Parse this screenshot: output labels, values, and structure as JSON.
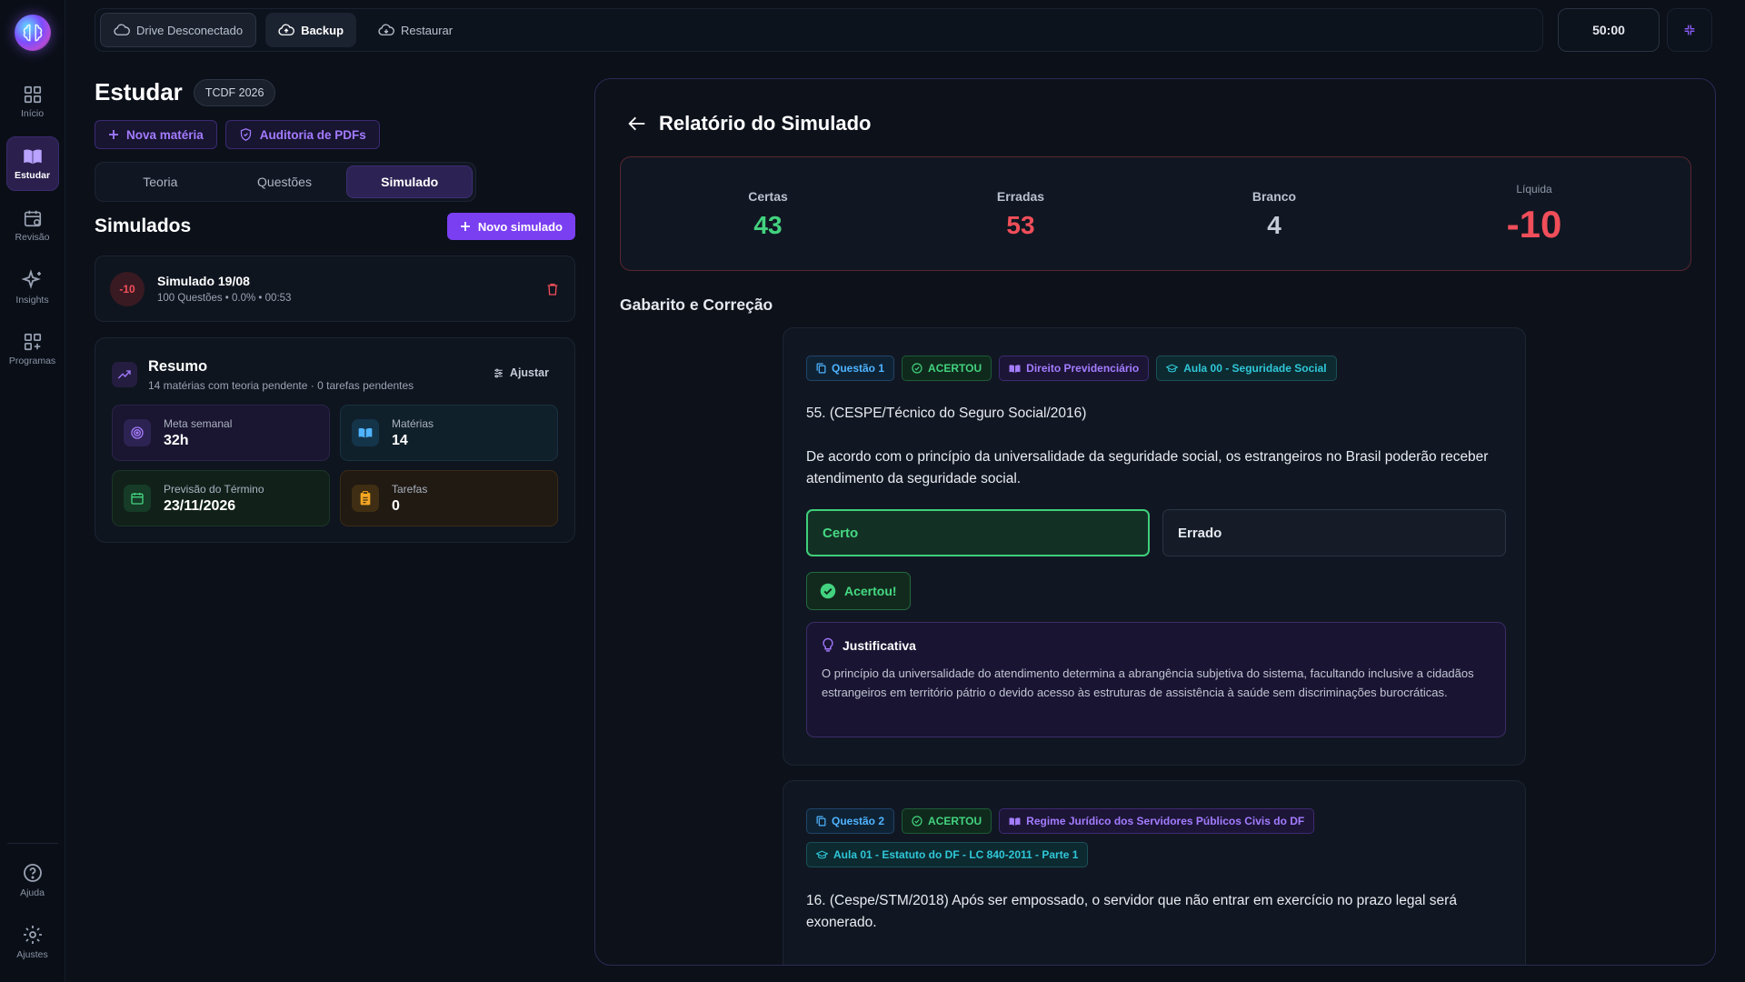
{
  "sidebar": {
    "items": [
      {
        "label": "Início",
        "icon": "grid-icon",
        "active": false
      },
      {
        "label": "Estudar",
        "icon": "book-icon",
        "active": true
      },
      {
        "label": "Revisão",
        "icon": "calendar-icon",
        "active": false
      },
      {
        "label": "Insights",
        "icon": "sparkles-icon",
        "active": false
      },
      {
        "label": "Programas",
        "icon": "apps-icon",
        "active": false
      }
    ],
    "bottom": [
      {
        "label": "Ajuda",
        "icon": "help-icon"
      },
      {
        "label": "Ajustes",
        "icon": "gear-icon"
      }
    ]
  },
  "topbar": {
    "drive": "Drive Desconectado",
    "backup": "Backup",
    "restore": "Restaurar",
    "timer": "50:00"
  },
  "page": {
    "title": "Estudar",
    "badge": "TCDF 2026",
    "new_subject": "Nova matéria",
    "audit": "Auditoria de PDFs",
    "tabs": [
      "Teoria",
      "Questões",
      "Simulado"
    ],
    "active_tab": "Simulado"
  },
  "simulados": {
    "title": "Simulados",
    "new_button": "Novo simulado",
    "items": [
      {
        "score": "-10",
        "name": "Simulado 19/08",
        "meta": "100 Questões • 0.0% • 00:53"
      }
    ]
  },
  "resumo": {
    "title": "Resumo",
    "subtitle": "14 matérias com teoria pendente · 0 tarefas pendentes",
    "adjust": "Ajustar",
    "stats": {
      "meta": {
        "label": "Meta semanal",
        "value": "32h"
      },
      "materias": {
        "label": "Matérias",
        "value": "14"
      },
      "previsao": {
        "label": "Previsão do Término",
        "value": "23/11/2026"
      },
      "tarefas": {
        "label": "Tarefas",
        "value": "0"
      }
    }
  },
  "report": {
    "title": "Relatório do Simulado",
    "scores": {
      "certas": {
        "label": "Certas",
        "value": "43",
        "color": "#43d27f"
      },
      "erradas": {
        "label": "Erradas",
        "value": "53",
        "color": "#f04e5a"
      },
      "branco": {
        "label": "Branco",
        "value": "4",
        "color": "#c5ccd8"
      },
      "liquida": {
        "label": "Líquida",
        "value": "-10",
        "color": "#f04e5a"
      }
    },
    "section_title": "Gabarito e Correção",
    "questions": [
      {
        "number": "Questão 1",
        "status": "ACERTOU",
        "subject": "Direito Previdenciário",
        "lesson": "Aula 00 - Seguridade Social",
        "source": "55. (CESPE/Técnico do Seguro Social/2016)",
        "statement": "De acordo com o princípio da universalidade da seguridade social, os estrangeiros no Brasil poderão receber atendimento da seguridade social.",
        "option_a": "Certo",
        "option_b": "Errado",
        "result": "Acertou!",
        "justification_title": "Justificativa",
        "justification": "O princípio da universalidade do atendimento determina a abrangência subjetiva do sistema, facultando inclusive a cidadãos estrangeiros em território pátrio o devido acesso às estruturas de assistência à saúde sem discriminações burocráticas."
      },
      {
        "number": "Questão 2",
        "status": "ACERTOU",
        "subject": "Regime Jurídico dos Servidores Públicos Civis do DF",
        "lesson": "Aula 01 - Estatuto do DF - LC 840-2011 - Parte 1",
        "statement": "16. (Cespe/STM/2018) Após ser empossado, o servidor que não entrar em exercício no prazo legal será exonerado."
      }
    ]
  }
}
